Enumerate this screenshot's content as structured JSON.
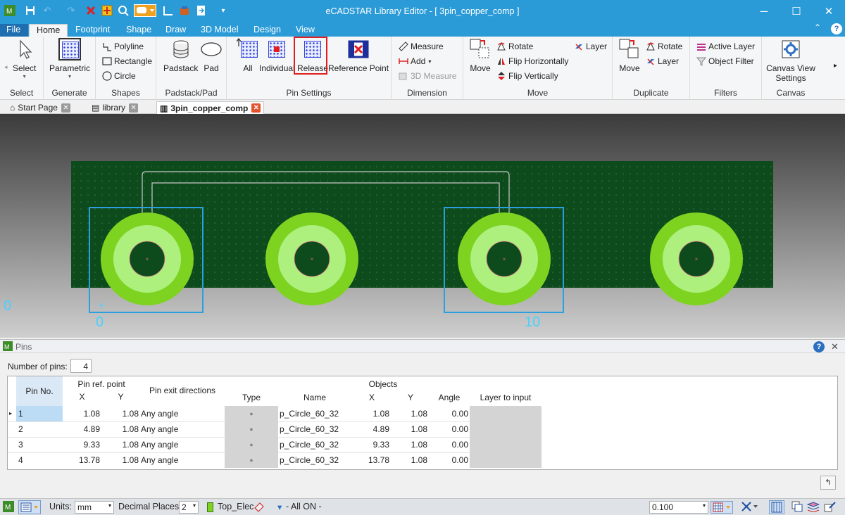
{
  "window": {
    "title": "eCADSTAR Library Editor - [ 3pin_copper_comp ]",
    "minimize": "─",
    "maximize": "☐",
    "close": "✕"
  },
  "menu": {
    "tabs": [
      "File",
      "Home",
      "Footprint",
      "Shape",
      "Draw",
      "3D Model",
      "Design",
      "View"
    ],
    "active": "Home",
    "collapse_glyph": "⌃",
    "help_glyph": "?"
  },
  "ribbon": {
    "select": {
      "button": "Select",
      "group": "Select"
    },
    "generate": {
      "button": "Parametric",
      "group": "Generate"
    },
    "shapes": {
      "polyline": "Polyline",
      "rectangle": "Rectangle",
      "circle": "Circle",
      "group": "Shapes"
    },
    "padstack": {
      "padstack": "Padstack",
      "pad": "Pad",
      "group": "Padstack/Pad"
    },
    "pin_settings": {
      "all": "All",
      "individual": "Individual",
      "release": "Release",
      "reference_point": "Reference Point",
      "group": "Pin Settings"
    },
    "dimension": {
      "measure": "Measure",
      "add": "Add",
      "measure3d": "3D Measure",
      "group": "Dimension"
    },
    "move": {
      "move": "Move",
      "rotate": "Rotate",
      "flip_h": "Flip Horizontally",
      "flip_v": "Flip Vertically",
      "layer": "Layer",
      "group": "Move"
    },
    "duplicate": {
      "move": "Move",
      "rotate": "Rotate",
      "layer": "Layer",
      "group": "Duplicate"
    },
    "filters": {
      "active_layer": "Active Layer",
      "object_filter": "Object Filter",
      "group": "Filters"
    },
    "canvas": {
      "view_settings_1": "Canvas View",
      "view_settings_2": "Settings",
      "group": "Canvas"
    }
  },
  "doc_tabs": [
    {
      "label": "Start Page"
    },
    {
      "label": "library"
    },
    {
      "label": "3pin_copper_comp",
      "active": true
    }
  ],
  "canvas": {
    "axis_labels": [
      "0",
      "0",
      "10"
    ]
  },
  "pins_panel": {
    "title": "Pins",
    "number_of_pins_label": "Number of pins:",
    "number_of_pins": "4",
    "headers": {
      "pin_no": "Pin No.",
      "ref_point": "Pin ref. point",
      "ref_x": "X",
      "ref_y": "Y",
      "exit_dirs": "Pin exit directions",
      "objects": "Objects",
      "type": "Type",
      "name": "Name",
      "obj_x": "X",
      "obj_y": "Y",
      "angle": "Angle",
      "layer_to_input": "Layer to input"
    },
    "rows": [
      {
        "pin": "1",
        "x": "1.08",
        "y": "1.08",
        "exit": "Any angle",
        "name": "p_Circle_60_32",
        "ox": "1.08",
        "oy": "1.08",
        "angle": "0.00"
      },
      {
        "pin": "2",
        "x": "4.89",
        "y": "1.08",
        "exit": "Any angle",
        "name": "p_Circle_60_32",
        "ox": "4.89",
        "oy": "1.08",
        "angle": "0.00"
      },
      {
        "pin": "3",
        "x": "9.33",
        "y": "1.08",
        "exit": "Any angle",
        "name": "p_Circle_60_32",
        "ox": "9.33",
        "oy": "1.08",
        "angle": "0.00"
      },
      {
        "pin": "4",
        "x": "13.78",
        "y": "1.08",
        "exit": "Any angle",
        "name": "p_Circle_60_32",
        "ox": "13.78",
        "oy": "1.08",
        "angle": "0.00"
      }
    ]
  },
  "statusbar": {
    "units_label": "Units:",
    "units": "mm",
    "decimal_label": "Decimal Places:",
    "decimal": "2",
    "layer": "Top_Elec",
    "filter": "- All ON -",
    "grid": "0.100"
  },
  "colors": {
    "title_bar": "#2b9bd8",
    "board": "#0d4a1c",
    "pad_outer": "#7ed321",
    "pad_inner": "#aef07e",
    "selection": "#2aa0e0",
    "highlight": "#e02020"
  }
}
